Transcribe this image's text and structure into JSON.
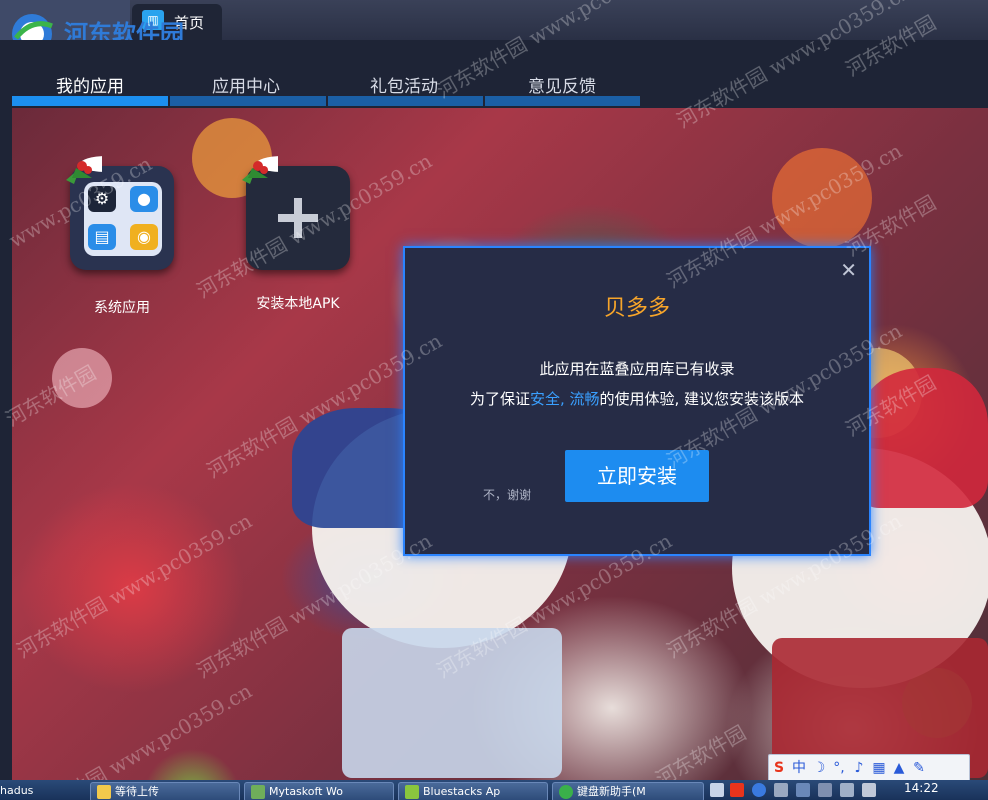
{
  "window": {
    "home_tab": "首页",
    "watermark_logo": "河东软件园",
    "watermark_url": "www.pc0359.cn"
  },
  "nav": {
    "tabs": [
      {
        "label": "我的应用",
        "active": true
      },
      {
        "label": "应用中心",
        "active": false
      },
      {
        "label": "礼包活动",
        "active": false
      },
      {
        "label": "意见反馈",
        "active": false
      }
    ]
  },
  "apps": [
    {
      "label": "系统应用",
      "icon": "system-apps-grid-icon"
    },
    {
      "label": "安装本地APK",
      "icon": "plus-icon"
    }
  ],
  "dialog": {
    "title": "贝多多",
    "line1": "此应用在蓝叠应用库已有收录",
    "line2_prefix": "为了保证",
    "line2_highlight": "安全, 流畅",
    "line2_suffix": "的使用体验, 建议您安装该版本",
    "install_label": "立即安装",
    "no_thanks_label": "不，谢谢",
    "close_icon": "close-icon",
    "title_color": "#f7a52a",
    "highlight_color": "#3aa0ff",
    "button_color": "#1d8cf0"
  },
  "taskbar": {
    "items": [
      {
        "label": "等待上传"
      },
      {
        "label": "Mytaskoft Wo"
      },
      {
        "label": "Bluestacks Ap"
      },
      {
        "label": "键盘新助手(M"
      }
    ],
    "clock": "14:22",
    "partial_left": "hadus"
  },
  "ime": {
    "buttons": [
      "S",
      "中",
      "☽",
      "°,",
      "mic",
      "kbd",
      "shirt",
      "wrench"
    ]
  }
}
